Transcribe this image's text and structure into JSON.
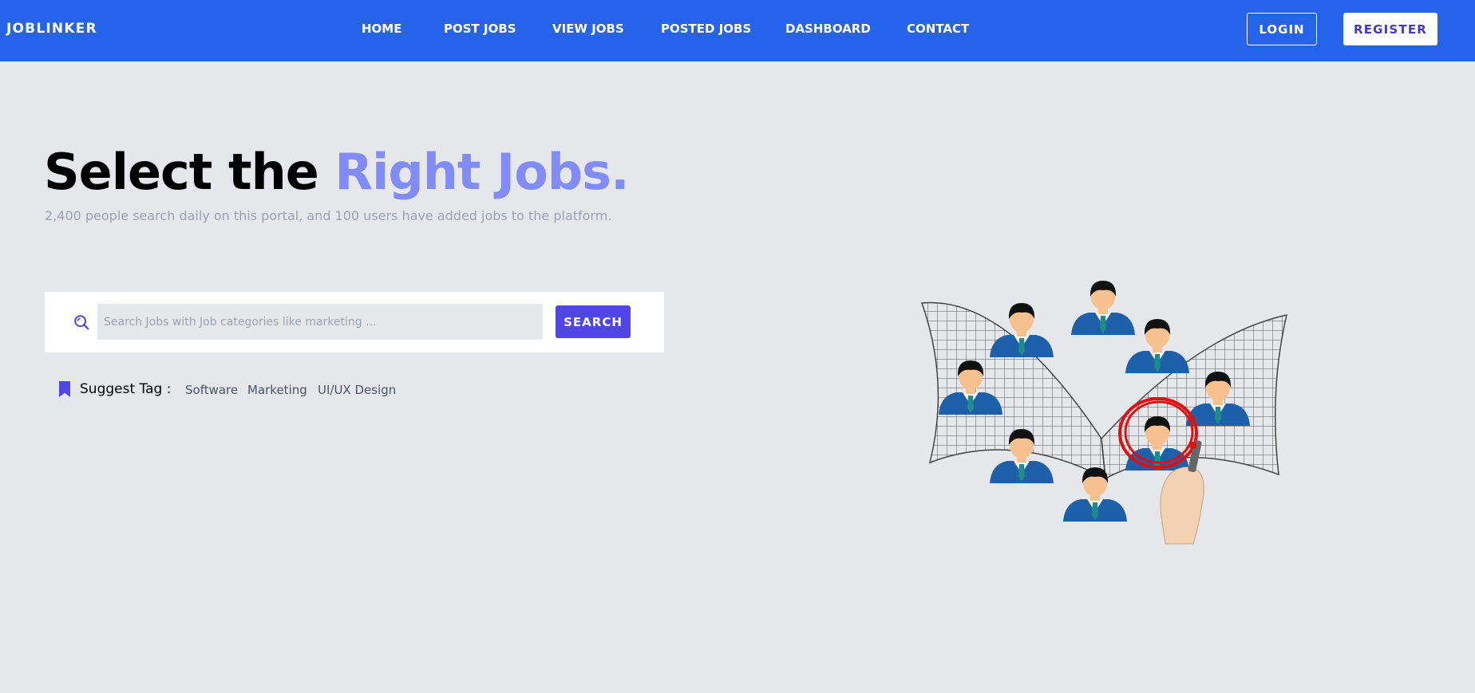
{
  "navbar": {
    "brand": "JOBLINKER",
    "links": [
      "HOME",
      "POST JOBS",
      "VIEW JOBS",
      "POSTED JOBS",
      "DASHBOARD",
      "CONTACT"
    ],
    "login_label": "LOGIN",
    "register_label": "REGISTER",
    "bg_color": "#2563eb"
  },
  "hero": {
    "title_main": "Select the ",
    "title_accent": "Right Jobs.",
    "subtitle": "2,400 people search daily on this portal, and 100 users have added jobs to the platform.",
    "accent_color": "#818cf8"
  },
  "search": {
    "placeholder": "Search Jobs with Job categories like marketing ...",
    "value": "",
    "button_label": "SEARCH",
    "button_color": "#4f46e5",
    "icon": "search-icon"
  },
  "tags": {
    "label": "Suggest Tag :",
    "icon": "bookmark-icon",
    "items": [
      "Software",
      "Marketing",
      "UI/UX Design"
    ]
  },
  "illustration": {
    "description_icon": "recruitment-illustration"
  }
}
